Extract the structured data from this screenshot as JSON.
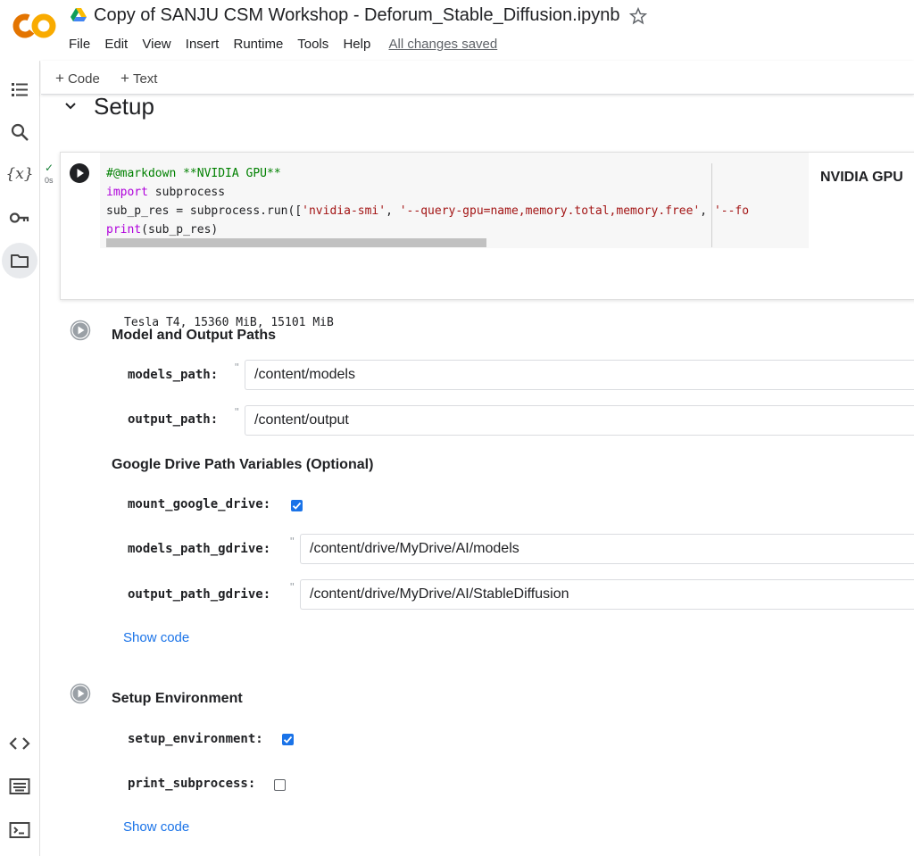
{
  "header": {
    "title": "Copy of SANJU CSM Workshop - Deforum_Stable_Diffusion.ipynb",
    "logo_text": "CO",
    "menu": [
      "File",
      "Edit",
      "View",
      "Insert",
      "Runtime",
      "Tools",
      "Help"
    ],
    "save_status": "All changes saved"
  },
  "sidebar": {
    "items": [
      "toc-icon",
      "search-icon",
      "variables-icon",
      "secrets-key-icon",
      "files-folder-icon"
    ],
    "bottom_items": [
      "code-snippets-icon",
      "command-palette-icon",
      "terminal-icon"
    ],
    "variables_label": "{x}"
  },
  "toolbar": {
    "add_code": "Code",
    "add_text": "Text",
    "plus": "+"
  },
  "section": {
    "title": "Setup"
  },
  "cell_gpu": {
    "exec_check": "✓",
    "exec_time": "0s",
    "code": {
      "line1": "#@markdown **NVIDIA GPU**",
      "line2_kw": "import",
      "line2_rest": " subprocess",
      "line3_a": "sub_p_res = subprocess.run([",
      "line3_s1": "'nvidia-smi'",
      "line3_b": ", ",
      "line3_s2": "'--query-gpu=name,memory.total,memory.free'",
      "line3_c": ", ",
      "line3_s3": "'--fo",
      "line4_fn": "print",
      "line4_rest": "(sub_p_res)"
    },
    "form_title": "NVIDIA GPU",
    "output": "Tesla T4, 15360 MiB, 15101 MiB"
  },
  "cell_paths": {
    "heading": "Model and Output Paths",
    "models_path_label": "models_path:",
    "models_path_value": "/content/models",
    "output_path_label": "output_path:",
    "output_path_value": "/content/output",
    "gdrive_heading": "Google Drive Path Variables (Optional)",
    "mount_label": "mount_google_drive:",
    "mount_checked": true,
    "models_gdrive_label": "models_path_gdrive:",
    "models_gdrive_value": "/content/drive/MyDrive/AI/models",
    "output_gdrive_label": "output_path_gdrive:",
    "output_gdrive_value": "/content/drive/MyDrive/AI/StableDiffusion",
    "quote": "\"",
    "show_code": "Show code"
  },
  "cell_env": {
    "heading": "Setup Environment",
    "setup_env_label": "setup_environment:",
    "setup_env_checked": true,
    "print_sub_label": "print_subprocess:",
    "print_sub_checked": false,
    "show_code": "Show code"
  },
  "colors": {
    "accent": "#1a73e8",
    "logo_orange": "#F9AB00",
    "logo_deep": "#E37400",
    "comment": "#008000",
    "keyword": "#af00db",
    "string": "#a31515"
  }
}
